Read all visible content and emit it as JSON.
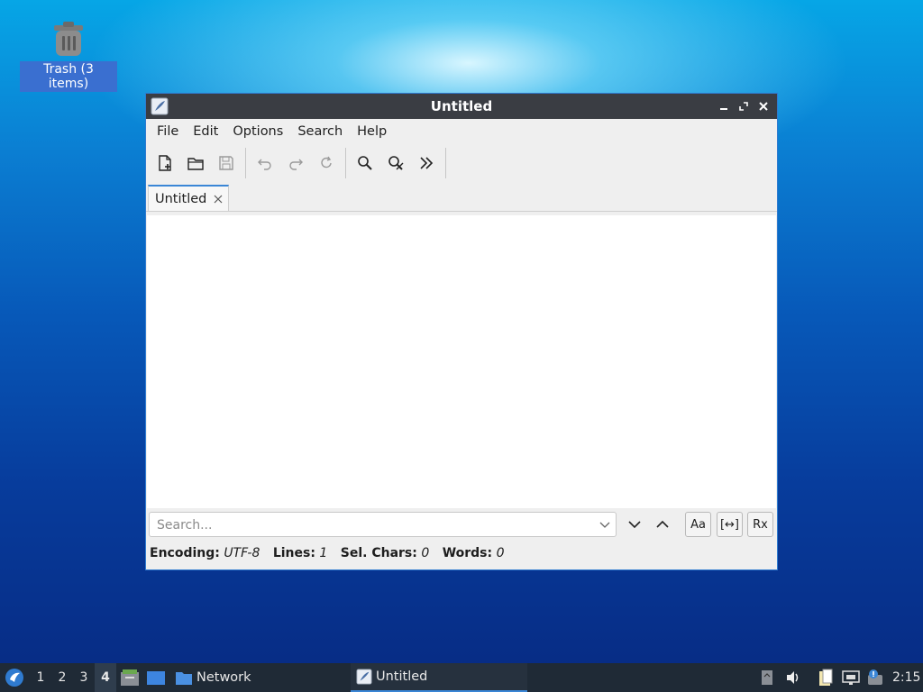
{
  "desktop": {
    "trash_label": "Trash (3 items)"
  },
  "window": {
    "title": "Untitled",
    "menu": [
      "File",
      "Edit",
      "Options",
      "Search",
      "Help"
    ],
    "toolbar_icons": [
      "new-document-icon",
      "open-folder-icon",
      "save-icon",
      "undo-icon",
      "redo-icon",
      "reload-icon",
      "find-icon",
      "find-replace-icon",
      "goto-line-icon"
    ],
    "tab": {
      "label": "Untitled"
    },
    "find": {
      "placeholder": "Search...",
      "buttons": {
        "match_case": "Aa",
        "whole_word": "[↔]",
        "regex": "Rx"
      }
    },
    "status": {
      "encoding_label": "Encoding:",
      "encoding_value": "UTF-8",
      "lines_label": "Lines:",
      "lines_value": "1",
      "selchars_label": "Sel. Chars:",
      "selchars_value": "0",
      "words_label": "Words:",
      "words_value": "0"
    }
  },
  "taskbar": {
    "workspaces": [
      "1",
      "2",
      "3",
      "4"
    ],
    "active_workspace": "4",
    "network_label": "Network",
    "task_label": "Untitled",
    "clock": "2:15"
  },
  "colors": {
    "accent": "#3a86d6",
    "titlebar": "#3a3d43",
    "taskbar": "#1f2a36"
  }
}
